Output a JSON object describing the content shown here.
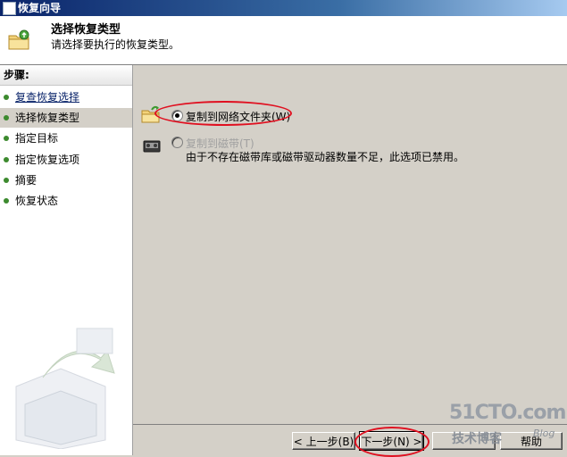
{
  "window": {
    "title": "恢复向导"
  },
  "header": {
    "title": "选择恢复类型",
    "subtitle": "请选择要执行的恢复类型。"
  },
  "sidebar": {
    "header": "步骤:",
    "items": [
      {
        "label": "复查恢复选择"
      },
      {
        "label": "选择恢复类型"
      },
      {
        "label": "指定目标"
      },
      {
        "label": "指定恢复选项"
      },
      {
        "label": "摘要"
      },
      {
        "label": "恢复状态"
      }
    ]
  },
  "options": {
    "network_folder": {
      "label": "复制到网络文件夹(W)",
      "selected": true
    },
    "tape": {
      "label": "复制到磁带(T)",
      "enabled": false,
      "description": "由于不存在磁带库或磁带驱动器数量不足，此选项已禁用。"
    }
  },
  "buttons": {
    "back": "< 上一步(B)",
    "next": "下一步(N) >",
    "cancel": "",
    "help": "帮助"
  },
  "watermark": {
    "site": "51CTO.com",
    "tagline": "技术博客",
    "blog": "Blog"
  },
  "colors": {
    "title_bar": "#0a246a",
    "highlight_ellipse": "#e01020",
    "step_dot": "#3c8a2e"
  }
}
